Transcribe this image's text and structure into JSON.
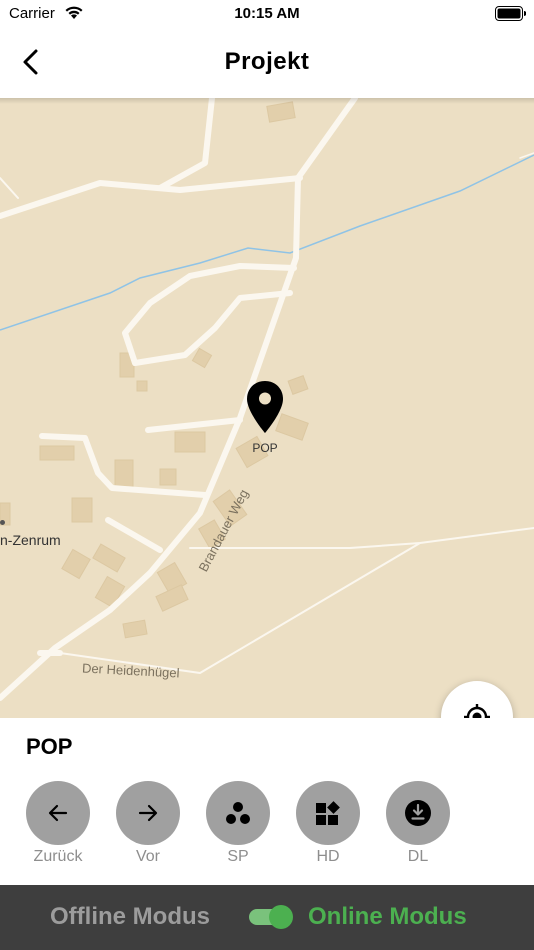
{
  "status_bar": {
    "carrier": "Carrier",
    "time": "10:15 AM"
  },
  "nav": {
    "title": "Projekt"
  },
  "map": {
    "pin_label": "POP",
    "streets": {
      "brandauer": "Brandauer Weg",
      "heidenhuegel": "Der Heidenhügel"
    },
    "place_partial": "n-Zenrum"
  },
  "panel": {
    "poi_title": "POP",
    "actions": [
      {
        "label": "Zurück",
        "icon": "arrow-left-icon"
      },
      {
        "label": "Vor",
        "icon": "arrow-right-icon"
      },
      {
        "label": "SP",
        "icon": "three-dots-icon"
      },
      {
        "label": "HD",
        "icon": "widgets-icon"
      },
      {
        "label": "DL",
        "icon": "download-icon"
      }
    ]
  },
  "mode": {
    "offline_label": "Offline Modus",
    "online_label": "Online Modus",
    "online_enabled": true
  },
  "colors": {
    "map_bg": "#ecdfc4",
    "road": "#fbf7ef",
    "water": "#8fc3e6",
    "building": "#e2cfab",
    "accent_green": "#4cb050",
    "button_grey": "#a0a0a0",
    "mode_bar": "#3e3e3e"
  }
}
